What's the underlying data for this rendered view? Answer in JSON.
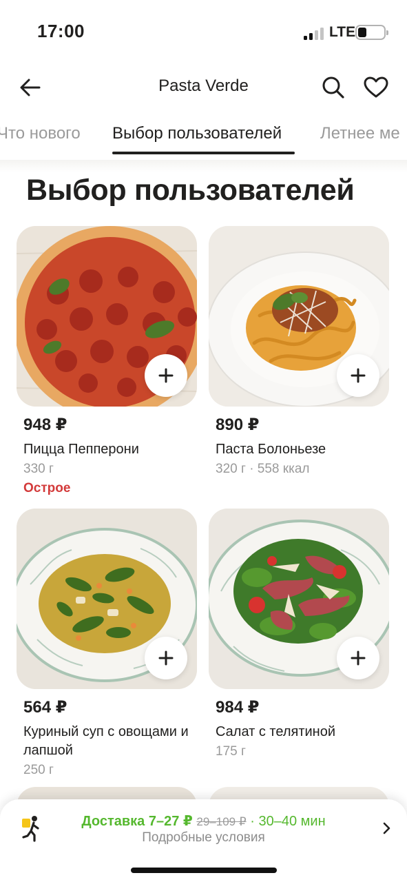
{
  "status": {
    "time": "17:00",
    "network": "LTE"
  },
  "header": {
    "title": "Pasta Verde"
  },
  "tabs": [
    {
      "label": "Что нового"
    },
    {
      "label": "Выбор пользователей"
    },
    {
      "label": "Летнее ме"
    }
  ],
  "section": {
    "title": "Выбор пользователей"
  },
  "products": [
    {
      "price": "948 ₽",
      "name": "Пицца Пепперони",
      "meta": "330 г",
      "tag": "Острое",
      "icon": "pizza-pepperoni"
    },
    {
      "price": "890 ₽",
      "name": "Паста Болоньезе",
      "meta": "320 г · 558 ккал",
      "icon": "pasta-bolognese"
    },
    {
      "price": "564 ₽",
      "name": "Куриный суп с овощами и лапшой",
      "meta": "250 г",
      "icon": "chicken-soup"
    },
    {
      "price": "984 ₽",
      "name": "Салат с телятиной",
      "meta": "175 г",
      "icon": "veal-salad"
    }
  ],
  "delivery": {
    "label": "Доставка 7–27 ₽",
    "old_price": "29–109 ₽",
    "separator": "·",
    "time": "30–40 мин",
    "details": "Подробные условия"
  },
  "colors": {
    "accent_green": "#55b82e",
    "spicy_red": "#d33a3a",
    "text": "#21201f",
    "muted": "#9a9a9a"
  },
  "icons": {
    "back": "arrow-left-icon",
    "search": "search-icon",
    "favorite": "heart-icon",
    "add": "plus-icon",
    "courier": "walking-courier-icon",
    "chevron": "chevron-right-icon"
  }
}
